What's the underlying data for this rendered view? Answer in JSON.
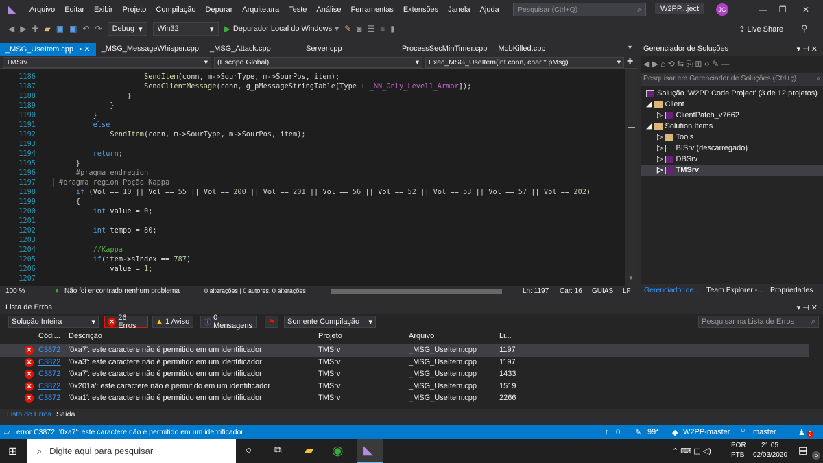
{
  "menu": [
    "Arquivo",
    "Editar",
    "Exibir",
    "Projeto",
    "Compilação",
    "Depurar",
    "Arquitetura",
    "Teste",
    "Análise",
    "Ferramentas",
    "Extensões",
    "Janela",
    "Ajuda"
  ],
  "search": {
    "placeholder": "Pesquisar (Ctrl+Q)"
  },
  "project_name": "W2PP...ject",
  "avatar": "JC",
  "toolbar": {
    "config": "Debug",
    "platform": "Win32",
    "debugger": "Depurador Local do Windows",
    "liveshare": "Live Share"
  },
  "tabs": [
    "_MSG_UseItem.cpp",
    "_MSG_MessageWhisper.cpp",
    "_MSG_Attack.cpp",
    "Server.cpp",
    "ProcessSecMinTimer.cpp",
    "MobKilled.cpp"
  ],
  "nav": {
    "project": "TMSrv",
    "scope": "(Escopo Global)",
    "function": "Exec_MSG_UseItem(int conn, char * pMsg)"
  },
  "code_lines": [
    {
      "n": "1186",
      "t": "                    SendItem(conn, m->SourType, m->SourPos, item);"
    },
    {
      "n": "1187",
      "t": "                    SendClientMessage(conn, g_pMessageStringTable[Type + _NN_Only_Level1_Armor]);"
    },
    {
      "n": "1188",
      "t": "                }"
    },
    {
      "n": "1189",
      "t": "            }"
    },
    {
      "n": "1190",
      "t": "        }"
    },
    {
      "n": "1191",
      "t": "        else"
    },
    {
      "n": "1192",
      "t": "            SendItem(conn, m->SourType, m->SourPos, item);"
    },
    {
      "n": "1193",
      "t": ""
    },
    {
      "n": "1194",
      "t": "        return;"
    },
    {
      "n": "1195",
      "t": "    }"
    },
    {
      "n": "1196",
      "t": "    #pragma endregion"
    },
    {
      "n": "1197",
      "t": "#pragma region Poção Kappa"
    },
    {
      "n": "1198",
      "t": "    if (Vol == 10 || Vol == 55 || Vol == 200 || Vol == 201 || Vol == 56 || Vol == 52 || Vol == 53 || Vol == 57 || Vol == 202)"
    },
    {
      "n": "1199",
      "t": "    {"
    },
    {
      "n": "1200",
      "t": "        int value = 0;"
    },
    {
      "n": "1201",
      "t": ""
    },
    {
      "n": "1202",
      "t": "        int tempo = 80;"
    },
    {
      "n": "1203",
      "t": ""
    },
    {
      "n": "1204",
      "t": "        //Kappa"
    },
    {
      "n": "1205",
      "t": "        if(item->sIndex == 787)"
    },
    {
      "n": "1206",
      "t": "            value = 1;"
    },
    {
      "n": "1207",
      "t": ""
    }
  ],
  "editor_status": {
    "zoom": "100 %",
    "issues": "Não foi encontrado nenhum problema",
    "changes": "0 alterações | 0 autores, 0 alterações",
    "ln": "Ln: 1197",
    "col": "Car: 16",
    "tabs": "GUIAS",
    "eol": "LF"
  },
  "solution": {
    "title": "Gerenciador de Soluções",
    "search": "Pesquisar em Gerenciador de Soluções (Ctrl+ç)",
    "root": "Solução 'W2PP Code Project' (3 de 12 projetos)",
    "items": [
      "Client",
      "ClientPatch_v7662",
      "Solution Items",
      "Tools",
      "BISrv (descarregado)",
      "DBSrv",
      "TMSrv"
    ],
    "tabs": [
      "Gerenciador de...",
      "Team Explorer -...",
      "Propriedades"
    ]
  },
  "errors": {
    "title": "Lista de Erros",
    "scope": "Solução Inteira",
    "count_errors": "26 Erros",
    "count_warnings": "1 Aviso",
    "count_messages": "0 Mensagens",
    "build_filter": "Somente Compilação",
    "search": "Pesquisar na Lista de Erros",
    "headers": [
      "Códi...",
      "Descrição",
      "Projeto",
      "Arquivo",
      "Li..."
    ],
    "rows": [
      {
        "code": "C3872",
        "desc": "'0xa7': este caractere não é permitido em um identificador",
        "proj": "TMSrv",
        "file": "_MSG_UseItem.cpp",
        "line": "1197"
      },
      {
        "code": "C3872",
        "desc": "'0xa3': este caractere não é permitido em um identificador",
        "proj": "TMSrv",
        "file": "_MSG_UseItem.cpp",
        "line": "1197"
      },
      {
        "code": "C3872",
        "desc": "'0xa7': este caractere não é permitido em um identificador",
        "proj": "TMSrv",
        "file": "_MSG_UseItem.cpp",
        "line": "1433"
      },
      {
        "code": "C3872",
        "desc": "'0x201a': este caractere não é permitido em um identificador",
        "proj": "TMSrv",
        "file": "_MSG_UseItem.cpp",
        "line": "1519"
      },
      {
        "code": "C3872",
        "desc": "'0xa1': este caractere não é permitido em um identificador",
        "proj": "TMSrv",
        "file": "_MSG_UseItem.cpp",
        "line": "2266"
      }
    ],
    "tabs": [
      "Lista de Erros",
      "Saída"
    ]
  },
  "statusbar": {
    "message": "error C3872: '0xa7': este caractere não é permitido em um identificador",
    "up": "0",
    "edits": "99*",
    "repo": "W2PP-master",
    "branch": "master",
    "notif": "2"
  },
  "taskbar": {
    "search": "Digite aqui para pesquisar",
    "lang1": "POR",
    "lang2": "PTB",
    "time": "21:05",
    "date": "02/03/2020",
    "notif": "5"
  }
}
